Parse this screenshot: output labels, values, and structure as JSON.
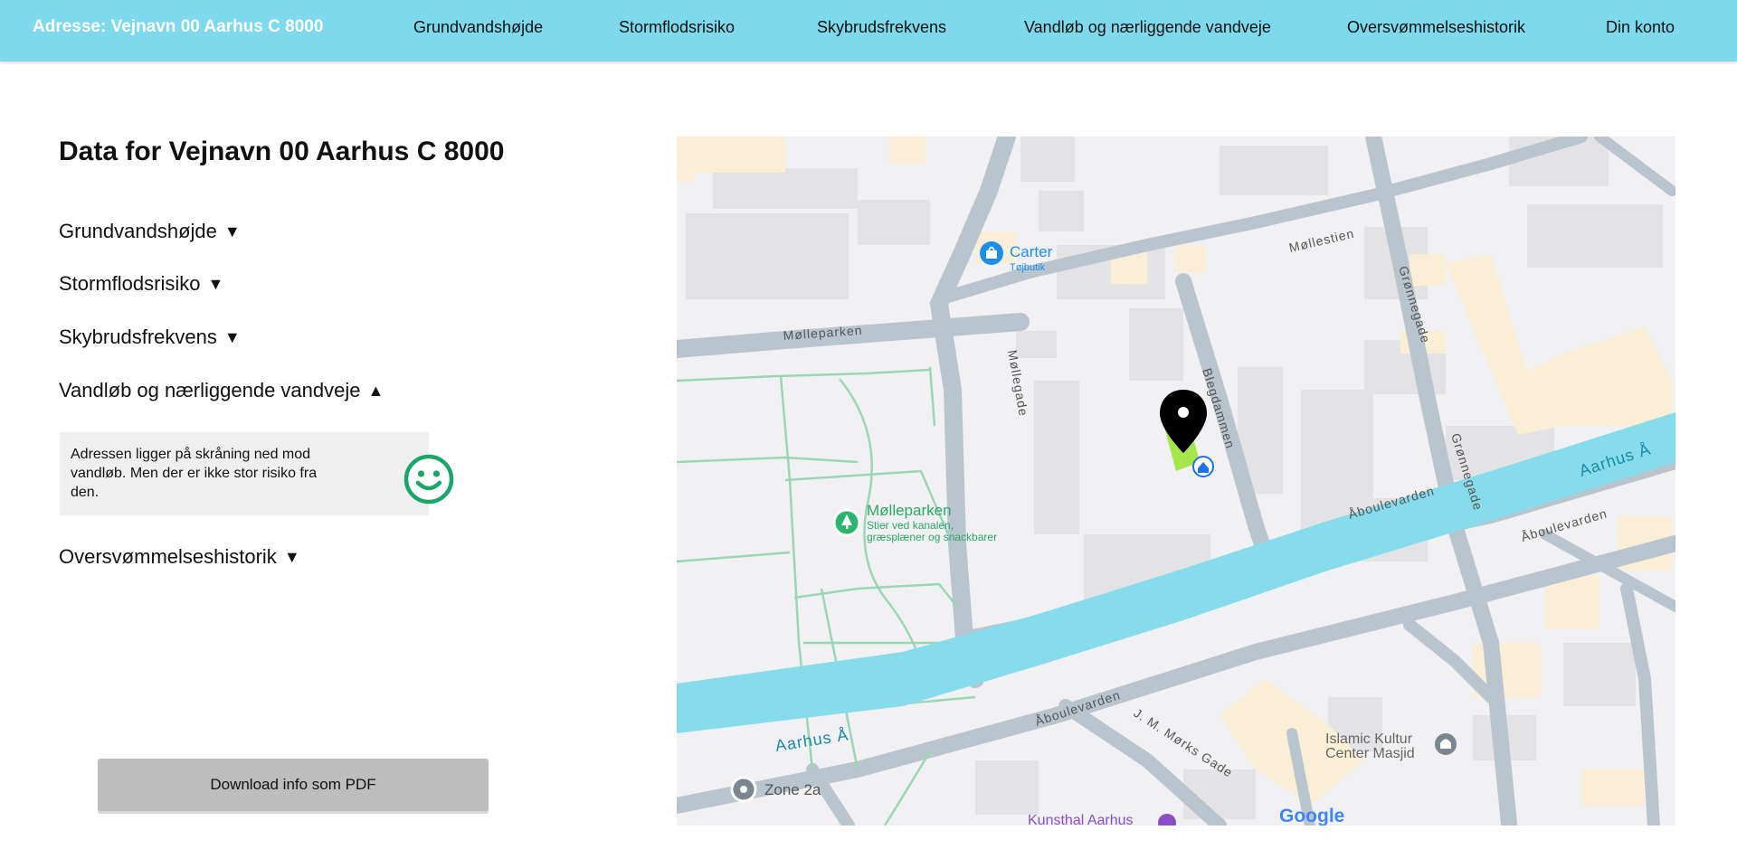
{
  "header": {
    "address": "Adresse: Vejnavn 00 Aarhus C 8000",
    "nav": [
      {
        "label": "Grundvandshøjde"
      },
      {
        "label": "Stormflodsrisiko"
      },
      {
        "label": "Skybrudsfrekvens"
      },
      {
        "label": "Vandløb og nærliggende vandveje"
      },
      {
        "label": "Oversvømmelseshistorik"
      },
      {
        "label": "Din konto"
      }
    ]
  },
  "main": {
    "title": "Data for Vejnavn 00 Aarhus C 8000",
    "sections": [
      {
        "label": "Grundvandshøjde",
        "arrow": "▼"
      },
      {
        "label": "Stormflodsrisiko",
        "arrow": "▼"
      },
      {
        "label": "Skybrudsfrekvens",
        "arrow": "▼"
      },
      {
        "label": "Vandløb og nærliggende vandveje",
        "arrow": "▲"
      },
      {
        "label": "Oversvømmelseshistorik",
        "arrow": "▼"
      }
    ],
    "info_text": "Adressen ligger på skråning ned mod vandløb. Men der er ikke stor risiko fra den.",
    "pdf_button": "Download info som PDF"
  },
  "map": {
    "streets": {
      "molleparken": "Mølleparken",
      "mollegade": "Møllegade",
      "mollestien": "Møllestien",
      "blegdammen": "Blegdammen",
      "gronnegade_1": "Grønnegade",
      "gronnegade_2": "Grønnegade",
      "aboulevarden_1": "Åboulevarden",
      "aboulevarden_2": "Åboulevarden",
      "aboulevarden_3": "Åboulevarden",
      "jm_morks_gade": "J. M. Mørks Gade",
      "aarhus_a_1": "Aarhus Å",
      "aarhus_a_2": "Aarhus Å"
    },
    "places": {
      "carter_name": "Carter",
      "carter_sub": "Tøjbutik",
      "park_name": "Mølleparken",
      "park_sub_1": "Stier ved kanalen,",
      "park_sub_2": "græsplæner og snackbarer",
      "islamic_1": "Islamic Kultur",
      "islamic_2": "Center Masjid",
      "zone": "Zone 2a",
      "kunsthal": "Kunsthal Aarhus",
      "google": "Google"
    },
    "colors": {
      "water": "#86dceb",
      "road": "#b8c4ce",
      "park_path": "#9ad6b4",
      "parcel": "#a5e64a",
      "header": "#7fd9ec",
      "smiley": "#1aa56a"
    }
  }
}
